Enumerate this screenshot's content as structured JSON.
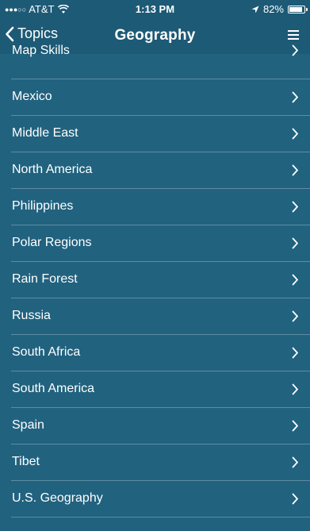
{
  "status_bar": {
    "signal": "●●●○○",
    "carrier": "AT&T",
    "time": "1:13 PM",
    "battery_percent": "82%",
    "battery_level": 0.82,
    "icons": [
      "wifi-icon",
      "location-arrow-icon",
      "battery-icon"
    ]
  },
  "nav": {
    "back_label": "Topics",
    "title": "Geography",
    "icons": [
      "chevron-left-icon",
      "hamburger-menu-icon"
    ]
  },
  "topics": [
    {
      "label": "Map Skills"
    },
    {
      "label": "Mexico"
    },
    {
      "label": "Middle East"
    },
    {
      "label": "North America"
    },
    {
      "label": "Philippines"
    },
    {
      "label": "Polar Regions"
    },
    {
      "label": "Rain Forest"
    },
    {
      "label": "Russia"
    },
    {
      "label": "South Africa"
    },
    {
      "label": "South America"
    },
    {
      "label": "Spain"
    },
    {
      "label": "Tibet"
    },
    {
      "label": "U.S. Geography"
    }
  ],
  "colors": {
    "background": "#21627f",
    "bar": "#1d5a76",
    "text": "#ffffff"
  }
}
